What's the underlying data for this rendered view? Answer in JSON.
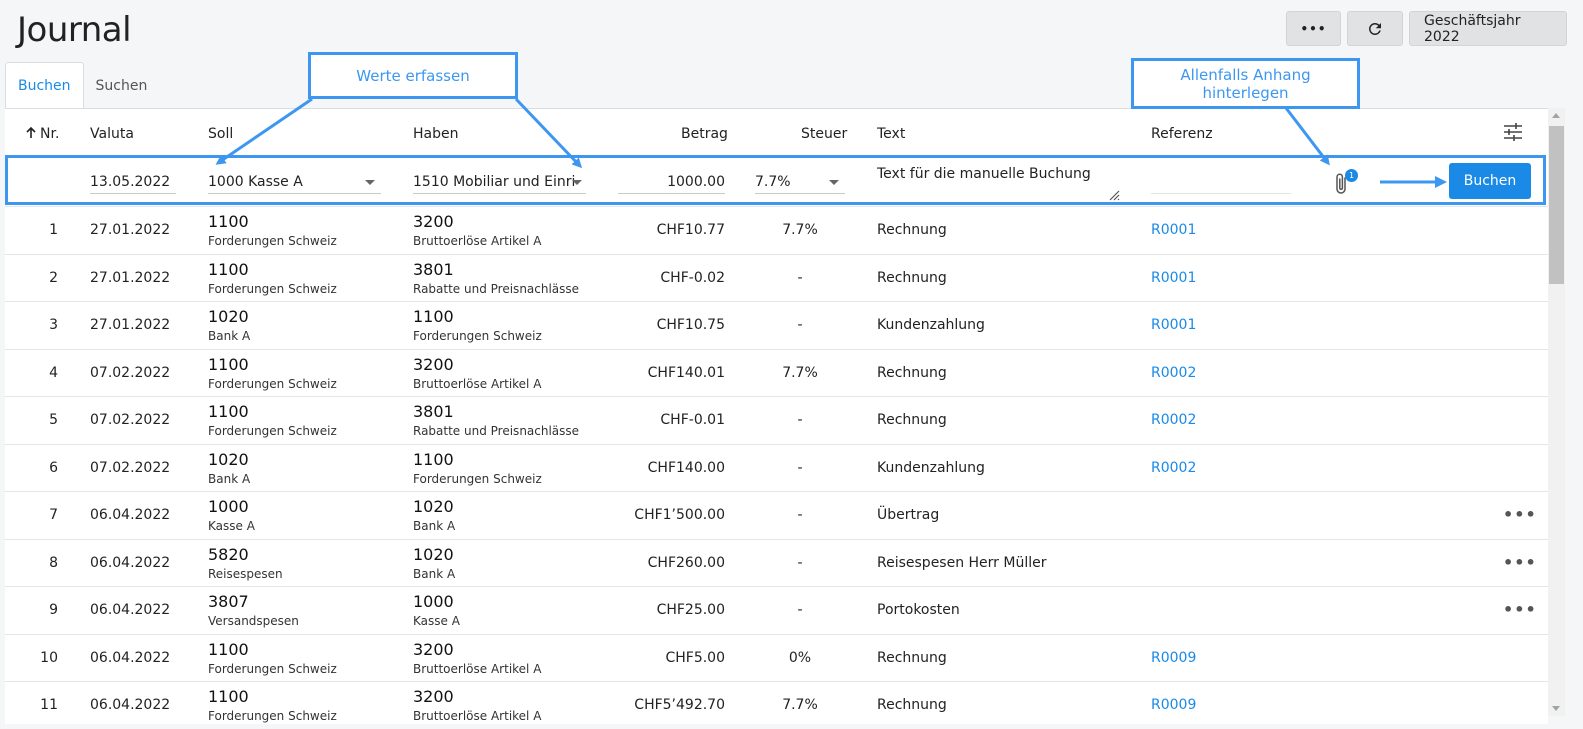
{
  "page": {
    "title": "Journal"
  },
  "top_actions": {
    "more_label": "•••",
    "fiscal_year_label": "Geschäftsjahr 2022"
  },
  "tabs": [
    {
      "label": "Buchen"
    },
    {
      "label": "Suchen"
    }
  ],
  "table": {
    "headers": {
      "nr": "Nr.",
      "valuta": "Valuta",
      "soll": "Soll",
      "haben": "Haben",
      "betrag": "Betrag",
      "steuer": "Steuer",
      "text": "Text",
      "referenz": "Referenz"
    },
    "entry": {
      "date": "13.05.2022",
      "soll": "1000 Kasse A",
      "haben": "1510 Mobiliar und Einri",
      "betrag": "1000.00",
      "steuer": "7.7%",
      "text": "Text für die manuelle Buchung",
      "attachment_count": "1",
      "submit_label": "Buchen"
    },
    "rows": [
      {
        "nr": "1",
        "date": "27.01.2022",
        "soll_num": "1100",
        "soll_name": "Forderungen Schweiz",
        "haben_num": "3200",
        "haben_name": "Bruttoerlöse Artikel A",
        "betrag": "CHF10.77",
        "steuer": "7.7%",
        "text": "Rechnung",
        "ref": "R0001",
        "more": ""
      },
      {
        "nr": "2",
        "date": "27.01.2022",
        "soll_num": "1100",
        "soll_name": "Forderungen Schweiz",
        "haben_num": "3801",
        "haben_name": "Rabatte und Preisnachlässe",
        "betrag": "CHF-0.02",
        "steuer": "-",
        "text": "Rechnung",
        "ref": "R0001",
        "more": ""
      },
      {
        "nr": "3",
        "date": "27.01.2022",
        "soll_num": "1020",
        "soll_name": "Bank A",
        "haben_num": "1100",
        "haben_name": "Forderungen Schweiz",
        "betrag": "CHF10.75",
        "steuer": "-",
        "text": "Kundenzahlung",
        "ref": "R0001",
        "more": ""
      },
      {
        "nr": "4",
        "date": "07.02.2022",
        "soll_num": "1100",
        "soll_name": "Forderungen Schweiz",
        "haben_num": "3200",
        "haben_name": "Bruttoerlöse Artikel A",
        "betrag": "CHF140.01",
        "steuer": "7.7%",
        "text": "Rechnung",
        "ref": "R0002",
        "more": ""
      },
      {
        "nr": "5",
        "date": "07.02.2022",
        "soll_num": "1100",
        "soll_name": "Forderungen Schweiz",
        "haben_num": "3801",
        "haben_name": "Rabatte und Preisnachlässe",
        "betrag": "CHF-0.01",
        "steuer": "-",
        "text": "Rechnung",
        "ref": "R0002",
        "more": ""
      },
      {
        "nr": "6",
        "date": "07.02.2022",
        "soll_num": "1020",
        "soll_name": "Bank A",
        "haben_num": "1100",
        "haben_name": "Forderungen Schweiz",
        "betrag": "CHF140.00",
        "steuer": "-",
        "text": "Kundenzahlung",
        "ref": "R0002",
        "more": ""
      },
      {
        "nr": "7",
        "date": "06.04.2022",
        "soll_num": "1000",
        "soll_name": "Kasse A",
        "haben_num": "1020",
        "haben_name": "Bank A",
        "betrag": "CHF1’500.00",
        "steuer": "-",
        "text": "Übertrag",
        "ref": "",
        "more": "•••"
      },
      {
        "nr": "8",
        "date": "06.04.2022",
        "soll_num": "5820",
        "soll_name": "Reisespesen",
        "haben_num": "1020",
        "haben_name": "Bank A",
        "betrag": "CHF260.00",
        "steuer": "-",
        "text": "Reisespesen Herr Müller",
        "ref": "",
        "more": "•••"
      },
      {
        "nr": "9",
        "date": "06.04.2022",
        "soll_num": "3807",
        "soll_name": "Versandspesen",
        "haben_num": "1000",
        "haben_name": "Kasse A",
        "betrag": "CHF25.00",
        "steuer": "-",
        "text": "Portokosten",
        "ref": "",
        "more": "•••"
      },
      {
        "nr": "10",
        "date": "06.04.2022",
        "soll_num": "1100",
        "soll_name": "Forderungen Schweiz",
        "haben_num": "3200",
        "haben_name": "Bruttoerlöse Artikel A",
        "betrag": "CHF5.00",
        "steuer": "0%",
        "text": "Rechnung",
        "ref": "R0009",
        "more": ""
      },
      {
        "nr": "11",
        "date": "06.04.2022",
        "soll_num": "1100",
        "soll_name": "Forderungen Schweiz",
        "haben_num": "3200",
        "haben_name": "Bruttoerlöse Artikel A",
        "betrag": "CHF5’492.70",
        "steuer": "7.7%",
        "text": "Rechnung",
        "ref": "R0009",
        "more": ""
      }
    ]
  },
  "annotations": {
    "werte": "Werte erfassen",
    "anhang": "Allenfalls Anhang hinterlegen"
  },
  "colors": {
    "accent": "#1a8ae6",
    "annotation": "#3d97f0"
  }
}
